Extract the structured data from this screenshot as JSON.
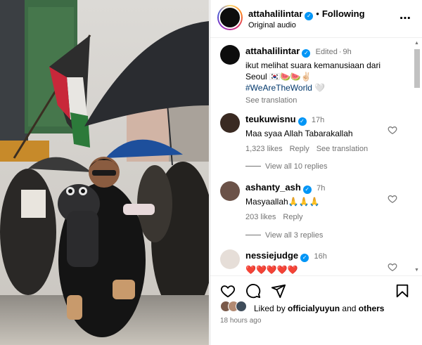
{
  "post": {
    "username": "attahalilintar",
    "follow_status": "Following",
    "audio": "Original audio",
    "more_icon": "more-horizontal-icon"
  },
  "caption": {
    "username": "attahalilintar",
    "edited": "Edited",
    "time": "9h",
    "text_line1": "ikut melihat suara kemanusiaan dari",
    "text_line2": "Seoul 🇰🇷🍉🍉✌🏻",
    "hashtag": "#WeAreTheWorld",
    "heart_emoji": "🤍",
    "see_translation": "See translation"
  },
  "comments": [
    {
      "username": "teukuwisnu",
      "time": "17h",
      "text": "Maa syaa Allah Tabarakallah",
      "likes": "1,323 likes",
      "reply": "Reply",
      "translation": "See translation",
      "view_replies": "View all 10 replies"
    },
    {
      "username": "ashanty_ash",
      "time": "7h",
      "text": "Masyaallah🙏🙏🙏",
      "likes": "203 likes",
      "reply": "Reply",
      "view_replies": "View all 3 replies"
    },
    {
      "username": "nessiejudge",
      "time": "16h",
      "text": "❤️❤️❤️❤️❤️"
    }
  ],
  "footer": {
    "liked_by_prefix": "Liked by",
    "liked_by_user": "officialyuyun",
    "liked_by_and": "and",
    "liked_by_others": "others",
    "time_ago": "18 hours ago"
  },
  "colors": {
    "verified": "#0095f6",
    "secondary_text": "#737373",
    "hashtag": "#00376b"
  }
}
